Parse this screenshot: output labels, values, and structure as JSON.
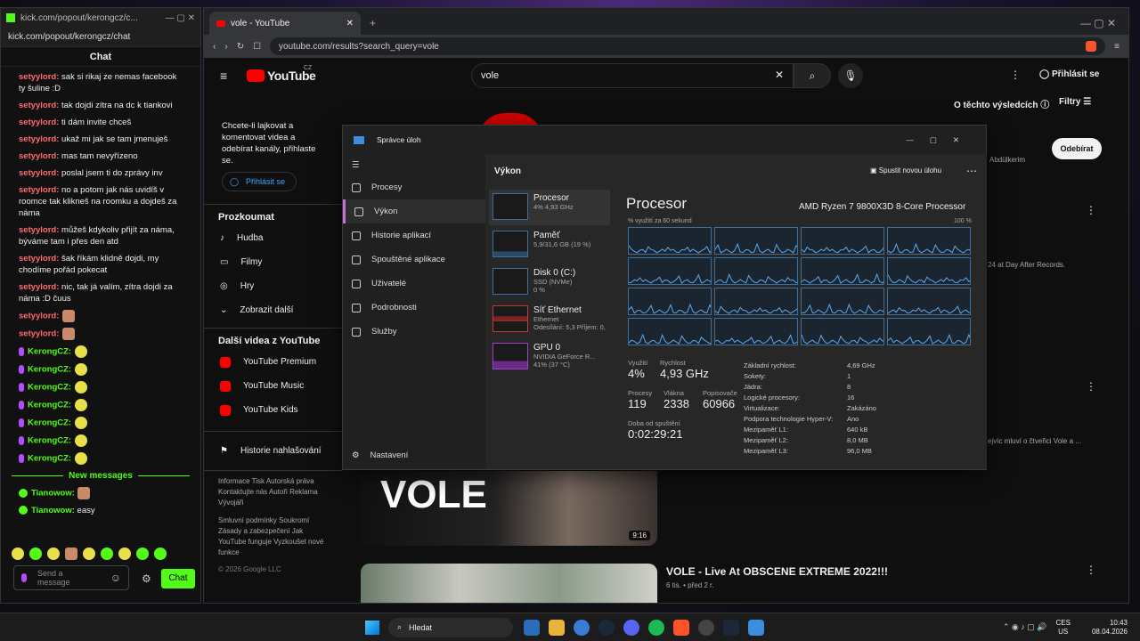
{
  "kick": {
    "url": "kick.com/popout/kerongcz/c...",
    "address": "kick.com/popout/kerongcz/chat",
    "header": "Chat",
    "new_messages": "New messages",
    "send_placeholder": "Send a message",
    "chat_button": "Chat",
    "messages": [
      {
        "user": "setyylord:",
        "text": "sak si rikaj ze nemas facebook ty šuline :D"
      },
      {
        "user": "setyylord:",
        "text": "tak dojdi zítra na dc k tiankovi"
      },
      {
        "user": "setyylord:",
        "text": "ti dám invite chceš"
      },
      {
        "user": "setyylord:",
        "text": "ukaž mi jak se tam jmenuješ"
      },
      {
        "user": "setyylord:",
        "text": "mas tam nevyřízeno"
      },
      {
        "user": "setyylord:",
        "text": "poslal jsem ti do zprávy inv"
      },
      {
        "user": "setyylord:",
        "text": "no a potom jak nás uvidíš v roomce tak klikneš na roomku a dojdeš za náma"
      },
      {
        "user": "setyylord:",
        "text": "můžeš kdykoliv přijít za náma, býváme tam i přes den atd"
      },
      {
        "user": "setyylord:",
        "text": "šak říkám klidně dojdi, my chodíme pořád pokecat"
      },
      {
        "user": "setyylord:",
        "text": "nic, tak já valím, zítra dojdi za náma :D čuus"
      }
    ],
    "emote_msgs": [
      "setyylord:",
      "setyylord:"
    ],
    "kerong_msgs": [
      "KerongCZ:",
      "KerongCZ:",
      "KerongCZ:",
      "KerongCZ:",
      "KerongCZ:",
      "KerongCZ:",
      "KerongCZ:"
    ],
    "tianowow": [
      {
        "user": "Tianowow:",
        "text": ""
      },
      {
        "user": "Tianowow:",
        "text": "easy"
      }
    ]
  },
  "youtube": {
    "tab_title": "vole - YouTube",
    "url": "youtube.com/results?search_query=vole",
    "logo": "YouTube",
    "logo_country": "CZ",
    "search_value": "vole",
    "signin": "Přihlásit se",
    "about_results": "O těchto výsledcích",
    "filters": "Filtry",
    "subscribe": "Odebírat",
    "signin_prompt": "Chcete-li lajkovat a komentovat videa a odebírat kanály, přihlaste se.",
    "signin_btn": "Přihlásit se",
    "explore_title": "Prozkoumat",
    "explore": [
      "Hudba",
      "Filmy",
      "Hry",
      "Zobrazit další"
    ],
    "more_title": "Další videa z YouTube",
    "more": [
      "YouTube Premium",
      "YouTube Music",
      "YouTube Kids"
    ],
    "report": "Historie nahlašování",
    "footer1": [
      "Informace",
      "Tisk",
      "Autorská práva",
      "Kontaktujte nás",
      "Autoři",
      "Reklama",
      "Vývojáři"
    ],
    "footer2": [
      "Smluvní podmínky",
      "Soukromí",
      "Zásady a zabezpečení",
      "Jak YouTube funguje",
      "Vyzkoušet nové funkce"
    ],
    "copyright": "© 2026 Google LLC",
    "channel_snip": "Abdülkerim",
    "desc1": "24 at Day After Records.",
    "desc2": "ejvíc mluví o čtveřici Vole a ...",
    "thumb_text": "VOLE",
    "duration": "9:16",
    "video2_title": "VOLE - Live At OBSCENE EXTREME 2022!!!",
    "video2_meta": "6 tis. • před 2 r."
  },
  "taskmgr": {
    "title": "Správce úloh",
    "nav": [
      "Procesy",
      "Výkon",
      "Historie aplikací",
      "Spouštěné aplikace",
      "Uživatelé",
      "Podrobnosti",
      "Služby"
    ],
    "settings": "Nastavení",
    "section": "Výkon",
    "run_task": "Spustit novou úlohu",
    "resources": [
      {
        "name": "Procesor",
        "l1": "4% 4,93 GHz",
        "l2": ""
      },
      {
        "name": "Paměť",
        "l1": "5,9/31,6 GB (19 %)",
        "l2": ""
      },
      {
        "name": "Disk 0 (C:)",
        "l1": "SSD (NVMe)",
        "l2": "0 %"
      },
      {
        "name": "Síť Ethernet",
        "l1": "Ethernet",
        "l2": "Odesílání: 5,3 Příjem: 0,"
      },
      {
        "name": "GPU 0",
        "l1": "NVIDIA GeForce R...",
        "l2": "41% (37 °C)"
      }
    ],
    "cpu_title": "Procesor",
    "cpu_model": "AMD Ryzen 7 9800X3D 8-Core Processor",
    "util_label": "% využití za 60 sekund",
    "util_max": "100 %",
    "stats": [
      {
        "l": "Využití",
        "v": "4%"
      },
      {
        "l": "Rychlost",
        "v": "4,93 GHz"
      },
      {
        "l": "Procesy",
        "v": "119"
      },
      {
        "l": "Vlákna",
        "v": "2338"
      },
      {
        "l": "Popisovače",
        "v": "60966"
      },
      {
        "l": "Doba od spuštění",
        "v": "0:02:29:21"
      }
    ],
    "specs": [
      [
        "Základní rychlost:",
        "4,69 GHz"
      ],
      [
        "Sokety:",
        "1"
      ],
      [
        "Jádra:",
        "8"
      ],
      [
        "Logické procesory:",
        "16"
      ],
      [
        "Virtualizace:",
        "Zakázáno"
      ],
      [
        "Podpora technologie Hyper-V:",
        "Ano"
      ],
      [
        "Mezipaměť L1:",
        "640 kB"
      ],
      [
        "Mezipaměť L2:",
        "8,0 MB"
      ],
      [
        "Mezipaměť L3:",
        "96,0 MB"
      ]
    ]
  },
  "taskbar": {
    "search": "Hledat",
    "lang1": "CES",
    "lang2": "US",
    "time": "10:43",
    "date": "08.04.2026"
  },
  "colors": {
    "kick_green": "#53fc18",
    "yt_red": "#ff0000",
    "tm_accent": "#c86dd7"
  }
}
